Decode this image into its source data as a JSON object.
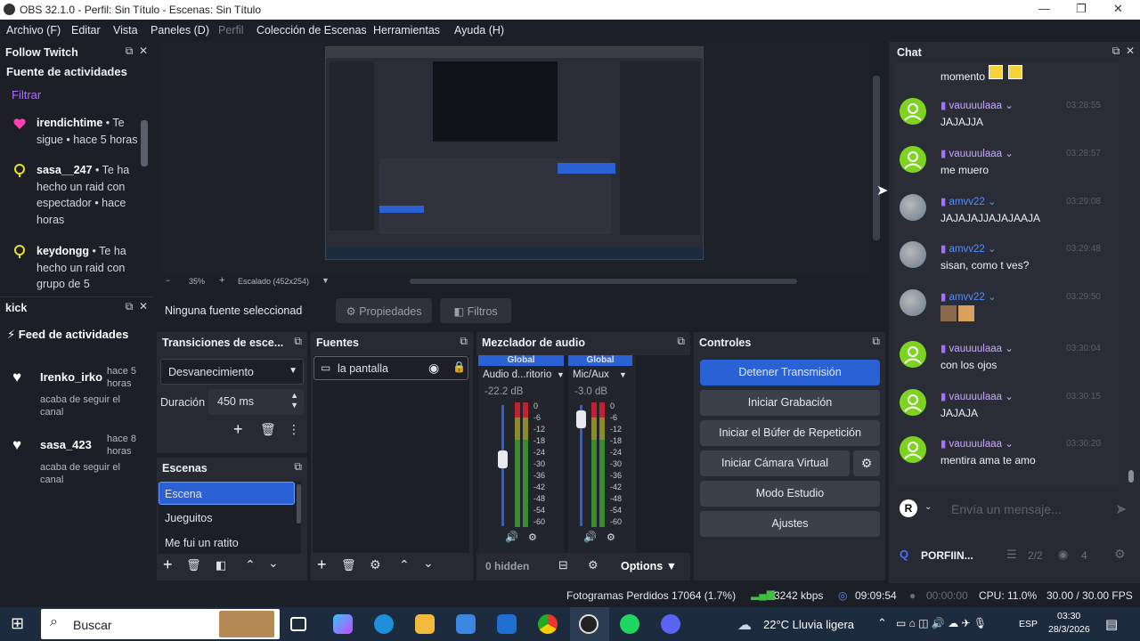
{
  "window": {
    "title": "OBS 32.1.0 - Perfil: Sin Título - Escenas: Sin Título"
  },
  "menu": [
    "Archivo (F)",
    "Editar",
    "Vista",
    "Paneles (D)",
    "Perfil",
    "Colección de Escenas",
    "Herramientas",
    "Ayuda (H)"
  ],
  "follow_twitch": {
    "title": "Follow Twitch",
    "subtitle": "Fuente de actividades",
    "filter": "Filtrar",
    "events": [
      {
        "icon": "heart-icon",
        "user": "irendichtime",
        "text": " • Te sigue • hace 5 horas"
      },
      {
        "icon": "raid-icon",
        "user": "sasa__247",
        "text": " • Te ha hecho un raid con espectador • hace horas"
      },
      {
        "icon": "raid-icon",
        "user": "keydongg",
        "text": " • Te ha hecho un raid con grupo de 5"
      }
    ]
  },
  "kick": {
    "title": "kick",
    "feed_title": "Feed de actividades",
    "events": [
      {
        "user": "Irenko_irko",
        "time": "hace 5 horas",
        "text": "acaba de seguir el canal"
      },
      {
        "user": "sasa_423",
        "time": "hace 8 horas",
        "text": "acaba de seguir el canal"
      }
    ]
  },
  "preview": {
    "zoom": "35%",
    "scale": "Escalado (452x254)"
  },
  "source_toolbar": {
    "none_selected": "Ninguna fuente seleccionad",
    "properties": "Propiedades",
    "filters": "Filtros"
  },
  "transitions": {
    "title": "Transiciones de esce...",
    "selected": "Desvanecimiento",
    "duration_label": "Duración",
    "duration_value": "450 ms"
  },
  "scenes": {
    "title": "Escenas",
    "items": [
      "Escena",
      "Jueguitos",
      "Me fui un ratito"
    ]
  },
  "sources": {
    "title": "Fuentes",
    "items": [
      "la pantalla"
    ]
  },
  "mixer": {
    "title": "Mezclador de audio",
    "channels": [
      {
        "tag": "Global",
        "name": "Audio d...ritorio",
        "db": "-22.2 dB",
        "fader": 0.55
      },
      {
        "tag": "Global",
        "name": "Mic/Aux",
        "db": "-3.0 dB",
        "fader": 0.88
      }
    ],
    "ticks": [
      "0",
      "-6",
      "-12",
      "-18",
      "-24",
      "-30",
      "-36",
      "-42",
      "-48",
      "-54",
      "-60"
    ],
    "hidden": "0 hidden",
    "options": "Options"
  },
  "controls": {
    "title": "Controles",
    "buttons": [
      "Detener Transmisión",
      "Iniciar Grabación",
      "Iniciar el Búfer de Repetición",
      "Iniciar Cámara Virtual",
      "Modo Estudio",
      "Ajustes"
    ]
  },
  "chat": {
    "title": "Chat",
    "top_text": "momento",
    "messages": [
      {
        "user": "vauuuulaaa",
        "text": "JAJAJJA",
        "time": "03:28:55",
        "avatar": "green"
      },
      {
        "user": "vauuuulaaa",
        "text": "me muero",
        "time": "03:28:57",
        "avatar": "green"
      },
      {
        "user": "amvv22",
        "text": "JAJAJAJJAJAJAAJA",
        "time": "03:29:08",
        "avatar": "photo"
      },
      {
        "user": "amvv22",
        "text": "sisan, como t ves?",
        "time": "03:29:48",
        "avatar": "photo"
      },
      {
        "user": "amvv22",
        "text": "",
        "time": "03:29:50",
        "avatar": "photo"
      },
      {
        "user": "vauuuulaaa",
        "text": "con los ojos",
        "time": "03:30:04",
        "avatar": "green"
      },
      {
        "user": "vauuuulaaa",
        "text": "JAJAJA",
        "time": "03:30:15",
        "avatar": "green"
      },
      {
        "user": "vauuuulaaa",
        "text": "mentira ama te amo",
        "time": "03:30:20",
        "avatar": "green"
      }
    ],
    "placeholder": "Envía un mensaje...",
    "channel": "PORFIIN...",
    "mods": "2/2",
    "viewers": "4"
  },
  "status": {
    "dropped": "Fotogramas Perdidos 17064 (1.7%)",
    "kbps": "3242 kbps",
    "stream_time": "09:09:54",
    "rec_time": "00:00:00",
    "cpu": "CPU: 11.0%",
    "fps": "30.00 / 30.00 FPS"
  },
  "taskbar": {
    "search": "Buscar",
    "weather": "22°C  Lluvia ligera",
    "lang": "ESP",
    "time": "03:30",
    "date": "28/3/2026"
  }
}
